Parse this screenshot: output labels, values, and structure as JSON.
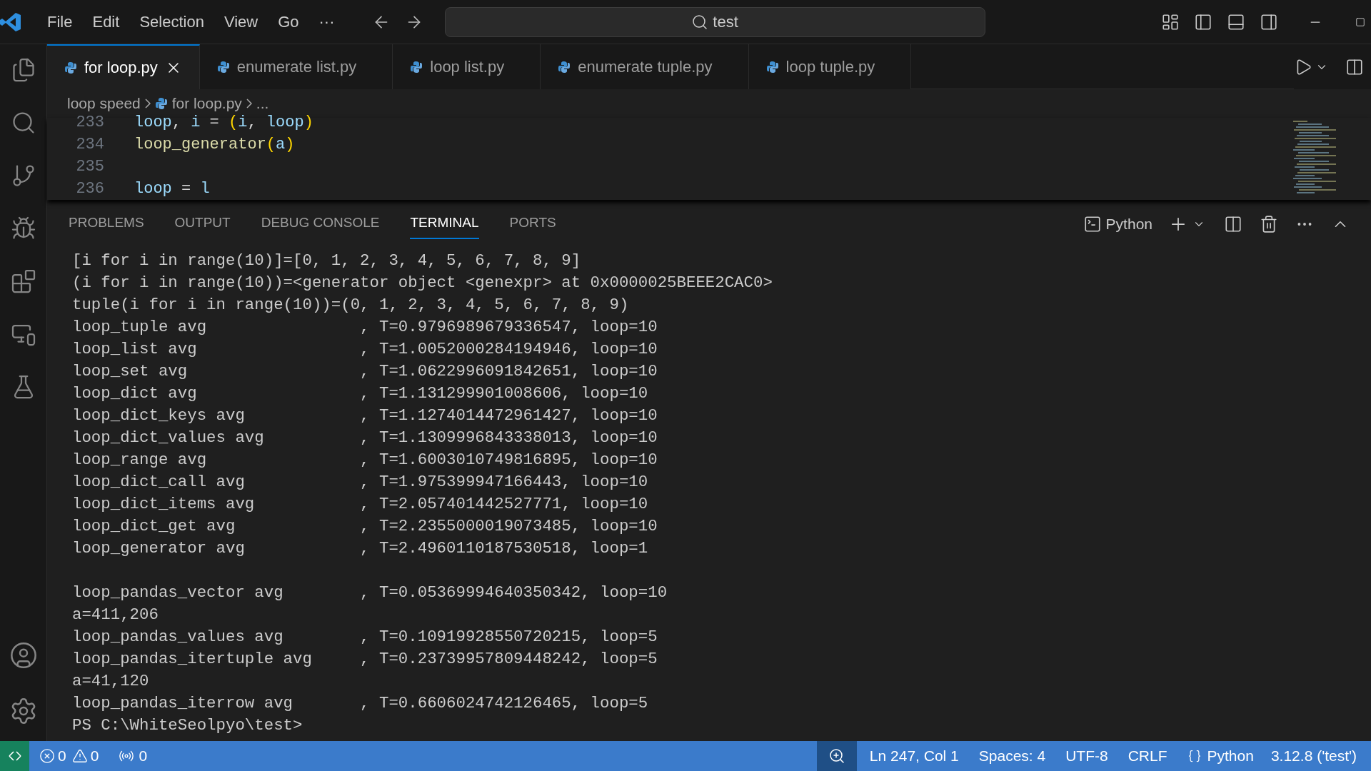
{
  "menu": [
    "File",
    "Edit",
    "Selection",
    "View",
    "Go",
    "···"
  ],
  "search": {
    "value": "test"
  },
  "tabs": [
    {
      "label": "for loop.py",
      "selected": true
    },
    {
      "label": "enumerate list.py",
      "selected": false
    },
    {
      "label": "loop list.py",
      "selected": false
    },
    {
      "label": "enumerate tuple.py",
      "selected": false
    },
    {
      "label": "loop tuple.py",
      "selected": false
    }
  ],
  "breadcrumb": [
    "loop speed",
    "for loop.py",
    "..."
  ],
  "editor": {
    "lines": [
      {
        "number": "233",
        "tokens": [
          {
            "text": "loop",
            "kind": "variable"
          },
          {
            "text": ", ",
            "kind": "punct"
          },
          {
            "text": "i",
            "kind": "variable"
          },
          {
            "text": " = ",
            "kind": "punct"
          },
          {
            "text": "(",
            "kind": "bracket"
          },
          {
            "text": "i",
            "kind": "variable"
          },
          {
            "text": ", ",
            "kind": "punct"
          },
          {
            "text": "loop",
            "kind": "variable"
          },
          {
            "text": ")",
            "kind": "bracket"
          }
        ]
      },
      {
        "number": "234",
        "tokens": [
          {
            "text": "loop_generator",
            "kind": "function"
          },
          {
            "text": "(",
            "kind": "bracket"
          },
          {
            "text": "a",
            "kind": "variable"
          },
          {
            "text": ")",
            "kind": "bracket"
          }
        ]
      },
      {
        "number": "235"
      },
      {
        "number": "236",
        "tokens": [
          {
            "text": "loop",
            "kind": "variable"
          },
          {
            "text": " = ",
            "kind": "punct"
          },
          {
            "text": "l",
            "kind": "variable"
          }
        ]
      }
    ]
  },
  "panel_tabs": [
    {
      "label": "PROBLEMS",
      "selected": false
    },
    {
      "label": "OUTPUT",
      "selected": false
    },
    {
      "label": "DEBUG CONSOLE",
      "selected": false
    },
    {
      "label": "TERMINAL",
      "selected": true
    },
    {
      "label": "PORTS",
      "selected": false
    }
  ],
  "terminal": {
    "profile": "Python",
    "sections": [
      [
        "[i for i in range(10)]=[0, 1, 2, 3, 4, 5, 6, 7, 8, 9]",
        "(i for i in range(10))=<generator object <genexpr> at 0x0000025BEEE2CAC0>",
        "tuple(i for i in range(10))=(0, 1, 2, 3, 4, 5, 6, 7, 8, 9)",
        "loop_tuple avg                , T=0.9796989679336547, loop=10",
        "loop_list avg                 , T=1.0052000284194946, loop=10",
        "loop_set avg                  , T=1.0622996091842651, loop=10",
        "loop_dict avg                 , T=1.131299901008606, loop=10",
        "loop_dict_keys avg            , T=1.1274014472961427, loop=10",
        "loop_dict_values avg          , T=1.1309996843338013, loop=10",
        "loop_range avg                , T=1.6003010749816895, loop=10",
        "loop_dict_call avg            , T=1.975399947166443, loop=10",
        "loop_dict_items avg           , T=2.057401442527771, loop=10",
        "loop_dict_get avg             , T=2.2355000019073485, loop=10",
        "loop_generator avg            , T=2.4960110187530518, loop=1"
      ],
      [
        "loop_pandas_vector avg        , T=0.05369994640350342, loop=10",
        "a=411,206",
        "loop_pandas_values avg        , T=0.10919928550720215, loop=5",
        "loop_pandas_itertuple avg     , T=0.23739957809448242, loop=5",
        "a=41,120",
        "loop_pandas_iterrow avg       , T=0.6606024742126465, loop=5",
        "PS C:\\WhiteSeolpyo\\test>"
      ]
    ]
  },
  "status_bar": {
    "errors": "0",
    "warnings": "0",
    "ports": "0",
    "position": "Ln 247, Col 1",
    "indent": "Spaces: 4",
    "encoding": "UTF-8",
    "eol": "CRLF",
    "language": "Python",
    "interpreter": "3.12.8 ('test')"
  }
}
